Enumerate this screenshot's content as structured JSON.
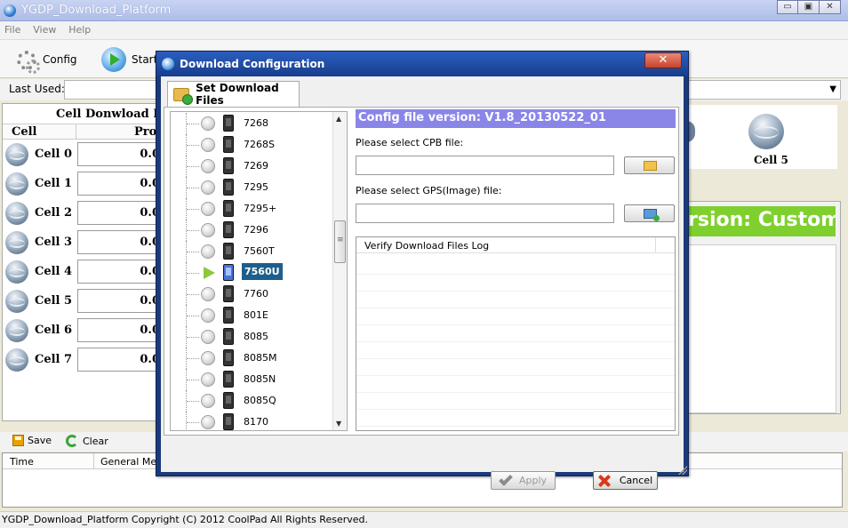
{
  "main_window": {
    "title": "YGDP_Download_Platform",
    "controls": {
      "minimize": "▭",
      "maximize": "▣",
      "close": "✕"
    },
    "menu": [
      "File",
      "View",
      "Help"
    ],
    "toolbar": {
      "config_label": "Config",
      "start_label": "Start"
    },
    "last_used": {
      "label": "Last Used:",
      "value": ""
    },
    "cell_panel": {
      "title": "Cell Donwload Pro",
      "col_cell": "Cell",
      "col_progress": "Proc",
      "cells": [
        {
          "name": "Cell 0",
          "progress": "0.0"
        },
        {
          "name": "Cell 1",
          "progress": "0.0"
        },
        {
          "name": "Cell 2",
          "progress": "0.0"
        },
        {
          "name": "Cell 3",
          "progress": "0.0"
        },
        {
          "name": "Cell 4",
          "progress": "0.0"
        },
        {
          "name": "Cell 5",
          "progress": "0.0"
        },
        {
          "name": "Cell 6",
          "progress": "0.0"
        },
        {
          "name": "Cell 7",
          "progress": "0.0"
        }
      ]
    },
    "cell5_label": "Cell 5",
    "version_banner": "rsion:  Custom",
    "log": {
      "save_label": "Save",
      "clear_label": "Clear",
      "col_time": "Time",
      "col_message": "General Mess"
    },
    "status": "YGDP_Download_Platform Copyright (C) 2012 CoolPad All Rights Reserved."
  },
  "dialog": {
    "title": "Download Configuration",
    "close": "✕",
    "tab_label": "Set Download Files",
    "tree_items": [
      {
        "label": "7268",
        "state": "idle"
      },
      {
        "label": "7268S",
        "state": "idle"
      },
      {
        "label": "7269",
        "state": "idle"
      },
      {
        "label": "7295",
        "state": "idle"
      },
      {
        "label": "7295+",
        "state": "idle"
      },
      {
        "label": "7296",
        "state": "idle"
      },
      {
        "label": "7560T",
        "state": "idle"
      },
      {
        "label": "7560U",
        "state": "selected"
      },
      {
        "label": "7760",
        "state": "idle"
      },
      {
        "label": "801E",
        "state": "idle"
      },
      {
        "label": "8085",
        "state": "idle"
      },
      {
        "label": "8085M",
        "state": "idle"
      },
      {
        "label": "8085N",
        "state": "idle"
      },
      {
        "label": "8085Q",
        "state": "idle"
      },
      {
        "label": "8170",
        "state": "idle"
      }
    ],
    "config_version": "Config file version: V1.8_20130522_01",
    "cpb_label": "Please select CPB file:",
    "cpb_value": "",
    "gps_label": "Please select GPS(Image) file:",
    "gps_value": "",
    "log_header": "Verify Download Files Log",
    "apply_label": "Apply",
    "cancel_label": "Cancel"
  }
}
